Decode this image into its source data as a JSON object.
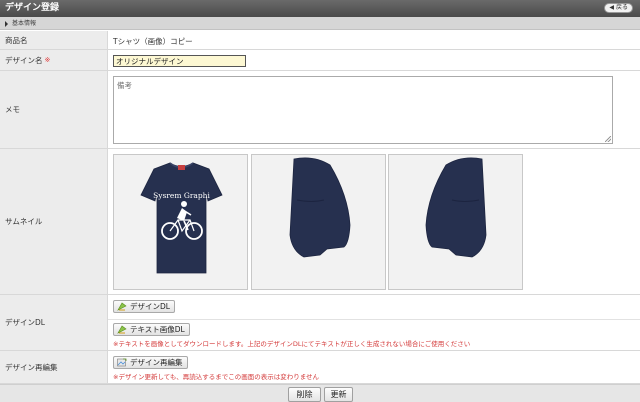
{
  "window": {
    "title": "デザイン登録",
    "back_label": "戻る"
  },
  "section": {
    "title": "基本情報"
  },
  "product": {
    "label": "商品名",
    "value": "Tシャツ（画像）コピー"
  },
  "design_name": {
    "label": "デザイン名",
    "required_mark": "※",
    "value": "オリジナルデザイン"
  },
  "memo": {
    "label": "メモ",
    "placeholder": "備考"
  },
  "thumbnail": {
    "label": "サムネイル",
    "tshirt_text": "Sysrem Graphi",
    "shirt_color": "#26304f"
  },
  "design_dl": {
    "label": "デザインDL",
    "button": "デザインDL",
    "text_image_button": "テキスト画像DL",
    "note": "※テキストを画像としてダウンロードします。上記のデザインDLにてテキストが正しく生成されない場合にご使用ください"
  },
  "design_reedit": {
    "label": "デザイン再編集",
    "button": "デザイン再編集",
    "note": "※デザイン更新しても、再読込するまでこの画面の表示は変わりません"
  },
  "footer": {
    "delete_label": "削除",
    "update_label": "更新"
  }
}
